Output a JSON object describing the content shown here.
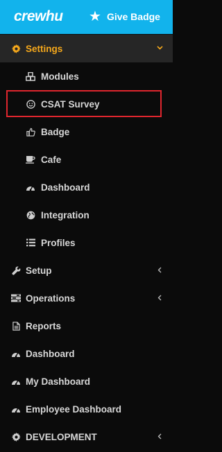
{
  "header": {
    "logo_text": "crewhu",
    "give_badge_label": "Give Badge",
    "give_badge_icon": "star-icon"
  },
  "menu": {
    "settings": {
      "label": "Settings",
      "icon": "gear-icon",
      "state": "expanded",
      "accent_color": "#f7a91b"
    },
    "submenu": [
      {
        "label": "Modules",
        "icon": "cubes-icon"
      },
      {
        "label": "CSAT Survey",
        "icon": "smiley-icon",
        "highlighted": true
      },
      {
        "label": "Badge",
        "icon": "thumbs-up-icon"
      },
      {
        "label": "Cafe",
        "icon": "coffee-cup-icon"
      },
      {
        "label": "Dashboard",
        "icon": "gauge-icon"
      },
      {
        "label": "Integration",
        "icon": "globe-icon"
      },
      {
        "label": "Profiles",
        "icon": "list-icon"
      }
    ],
    "items": [
      {
        "label": "Setup",
        "icon": "wrench-icon",
        "has_submenu": true
      },
      {
        "label": "Operations",
        "icon": "tasks-icon",
        "has_submenu": true
      },
      {
        "label": "Reports",
        "icon": "document-icon",
        "has_submenu": false
      },
      {
        "label": "Dashboard",
        "icon": "gauge-icon",
        "has_submenu": false
      },
      {
        "label": "My Dashboard",
        "icon": "gauge-icon",
        "has_submenu": false
      },
      {
        "label": "Employee Dashboard",
        "icon": "gauge-icon",
        "has_submenu": false
      },
      {
        "label": "DEVELOPMENT",
        "icon": "gear-icon",
        "has_submenu": true
      }
    ]
  },
  "colors": {
    "header_bg": "#12b3ec",
    "sidebar_bg": "#0b0b0b",
    "active_bg": "#262626",
    "highlight_border": "#e0262e"
  }
}
